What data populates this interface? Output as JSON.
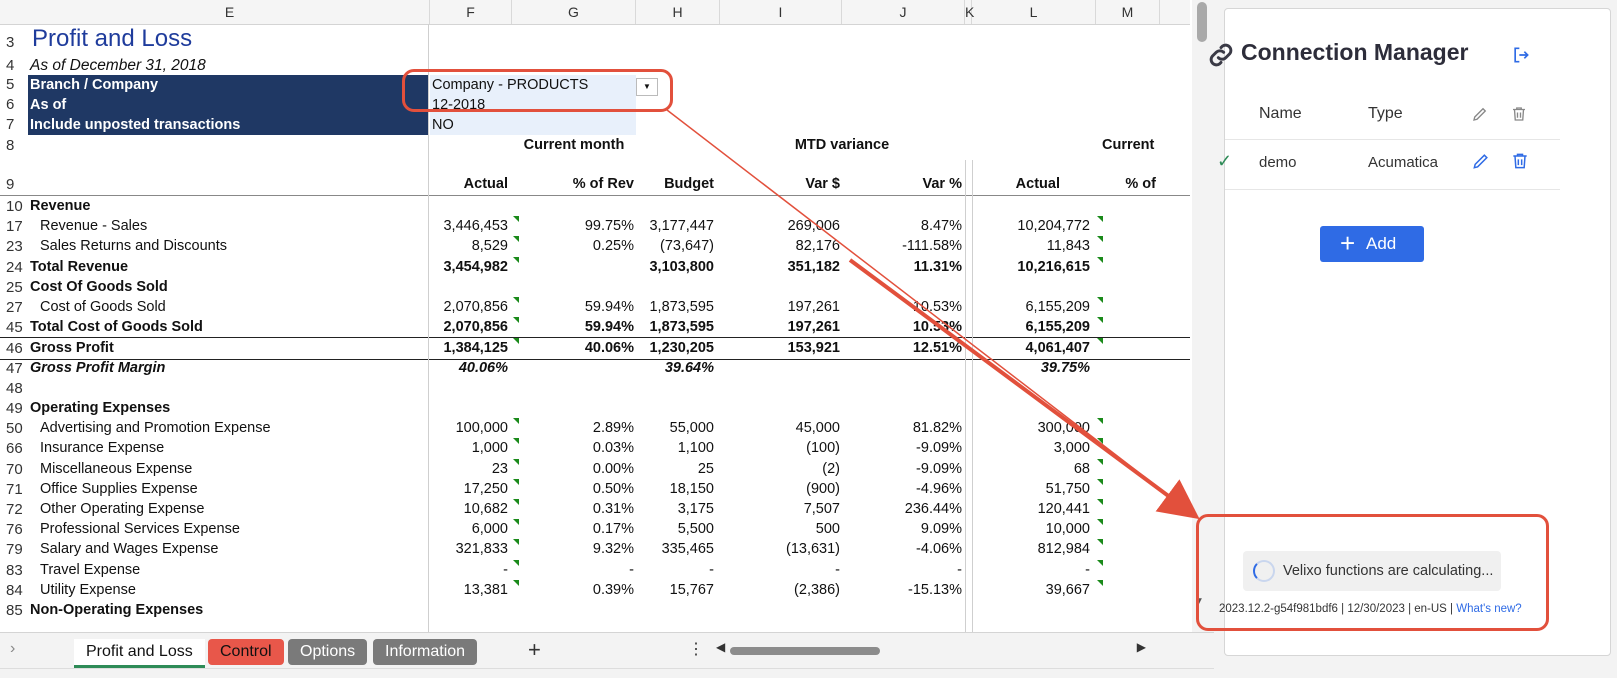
{
  "columns": [
    "E",
    "F",
    "G",
    "H",
    "I",
    "J",
    "K",
    "L",
    "M"
  ],
  "report": {
    "title": "Profit and Loss",
    "subtitle": "As of December 31, 2018",
    "params": [
      {
        "label": "Branch / Company",
        "value": "Company - PRODUCTS"
      },
      {
        "label": "As of",
        "value": "12-2018"
      },
      {
        "label": "Include unposted transactions",
        "value": "NO"
      }
    ],
    "group_headers": {
      "current_month": "Current month",
      "mtd_variance": "MTD variance",
      "current_ytd": "Current"
    },
    "col_headers": {
      "actual": "Actual",
      "pct_rev": "% of Rev",
      "budget": "Budget",
      "var_amt": "Var $",
      "var_pct": "Var %",
      "actual2": "Actual",
      "pct2": "% of"
    },
    "row_numbers": [
      "3",
      "4",
      "5",
      "6",
      "7",
      "8",
      "9",
      "10",
      "17",
      "23",
      "24",
      "25",
      "27",
      "45",
      "46",
      "47",
      "48",
      "49",
      "50",
      "66",
      "70",
      "71",
      "72",
      "76",
      "79",
      "83",
      "84",
      "85"
    ],
    "lines": [
      {
        "rn": "10",
        "label": "Revenue",
        "bold": true,
        "indent": false,
        "vals": [
          "",
          "",
          "",
          "",
          "",
          "",
          ""
        ]
      },
      {
        "rn": "17",
        "label": "Revenue - Sales",
        "bold": false,
        "indent": true,
        "vals": [
          "3,446,453",
          "99.75%",
          "3,177,447",
          "269,006",
          "8.47%",
          "10,204,772",
          ""
        ]
      },
      {
        "rn": "23",
        "label": "Sales Returns and Discounts",
        "bold": false,
        "indent": true,
        "vals": [
          "8,529",
          "0.25%",
          "(73,647)",
          "82,176",
          "-111.58%",
          "11,843",
          ""
        ]
      },
      {
        "rn": "24",
        "label": "Total Revenue",
        "bold": true,
        "indent": false,
        "vals": [
          "3,454,982",
          "",
          "3,103,800",
          "351,182",
          "11.31%",
          "10,216,615",
          ""
        ]
      },
      {
        "rn": "25",
        "label": "Cost Of Goods Sold",
        "bold": true,
        "indent": false,
        "vals": [
          "",
          "",
          "",
          "",
          "",
          "",
          ""
        ]
      },
      {
        "rn": "27",
        "label": "Cost of Goods Sold",
        "bold": false,
        "indent": true,
        "vals": [
          "2,070,856",
          "59.94%",
          "1,873,595",
          "197,261",
          "10.53%",
          "6,155,209",
          ""
        ]
      },
      {
        "rn": "45",
        "label": "Total Cost of Goods Sold",
        "bold": true,
        "indent": false,
        "vals": [
          "2,070,856",
          "59.94%",
          "1,873,595",
          "197,261",
          "10.53%",
          "6,155,209",
          ""
        ]
      },
      {
        "rn": "46",
        "label": "Gross Profit",
        "bold": true,
        "indent": false,
        "vals": [
          "1,384,125",
          "40.06%",
          "1,230,205",
          "153,921",
          "12.51%",
          "4,061,407",
          ""
        ]
      },
      {
        "rn": "47",
        "label": "Gross Profit Margin",
        "bold": true,
        "italic": true,
        "indent": false,
        "vals": [
          "40.06%",
          "",
          "39.64%",
          "",
          "",
          "39.75%",
          ""
        ]
      },
      {
        "rn": "48",
        "label": "",
        "bold": false,
        "indent": false,
        "vals": [
          "",
          "",
          "",
          "",
          "",
          "",
          ""
        ]
      },
      {
        "rn": "49",
        "label": "Operating Expenses",
        "bold": true,
        "indent": false,
        "vals": [
          "",
          "",
          "",
          "",
          "",
          "",
          ""
        ]
      },
      {
        "rn": "50",
        "label": "Advertising and Promotion Expense",
        "bold": false,
        "indent": true,
        "vals": [
          "100,000",
          "2.89%",
          "55,000",
          "45,000",
          "81.82%",
          "300,000",
          ""
        ]
      },
      {
        "rn": "66",
        "label": "Insurance Expense",
        "bold": false,
        "indent": true,
        "vals": [
          "1,000",
          "0.03%",
          "1,100",
          "(100)",
          "-9.09%",
          "3,000",
          ""
        ]
      },
      {
        "rn": "70",
        "label": "Miscellaneous Expense",
        "bold": false,
        "indent": true,
        "vals": [
          "23",
          "0.00%",
          "25",
          "(2)",
          "-9.09%",
          "68",
          ""
        ]
      },
      {
        "rn": "71",
        "label": "Office Supplies Expense",
        "bold": false,
        "indent": true,
        "vals": [
          "17,250",
          "0.50%",
          "18,150",
          "(900)",
          "-4.96%",
          "51,750",
          ""
        ]
      },
      {
        "rn": "72",
        "label": "Other Operating Expense",
        "bold": false,
        "indent": true,
        "vals": [
          "10,682",
          "0.31%",
          "3,175",
          "7,507",
          "236.44%",
          "120,441",
          ""
        ]
      },
      {
        "rn": "76",
        "label": "Professional Services Expense",
        "bold": false,
        "indent": true,
        "vals": [
          "6,000",
          "0.17%",
          "5,500",
          "500",
          "9.09%",
          "10,000",
          ""
        ]
      },
      {
        "rn": "79",
        "label": "Salary and Wages Expense",
        "bold": false,
        "indent": true,
        "vals": [
          "321,833",
          "9.32%",
          "335,465",
          "(13,631)",
          "-4.06%",
          "812,984",
          ""
        ]
      },
      {
        "rn": "83",
        "label": "Travel Expense",
        "bold": false,
        "indent": true,
        "vals": [
          "-",
          "-",
          "-",
          "-",
          "-",
          "-",
          ""
        ]
      },
      {
        "rn": "84",
        "label": "Utility Expense",
        "bold": false,
        "indent": true,
        "vals": [
          "13,381",
          "0.39%",
          "15,767",
          "(2,386)",
          "-15.13%",
          "39,667",
          ""
        ]
      },
      {
        "rn": "85",
        "label": "Non-Operating Expenses",
        "bold": true,
        "indent": false,
        "vals": [
          "",
          "",
          "",
          "",
          "",
          "",
          ""
        ]
      }
    ]
  },
  "sheet_tabs": [
    {
      "label": "Profit and Loss",
      "active": true
    },
    {
      "label": "Control",
      "color": "#e8574a"
    },
    {
      "label": "Options",
      "color": "#7a7a7a"
    },
    {
      "label": "Information",
      "color": "#7a7a7a"
    }
  ],
  "add_sheet": "+",
  "panel": {
    "title": "Connection Manager",
    "columns": {
      "name": "Name",
      "type": "Type"
    },
    "connections": [
      {
        "name": "demo",
        "type": "Acumatica"
      }
    ],
    "add_label": "Add",
    "status": "Velixo functions are calculating...",
    "version": "2023.12.2-g54f981bdf6 | 12/30/2023 | en-US | ",
    "whats_new": "What's new?",
    "accent": "#2f6be5"
  },
  "colors": {
    "annotation": "#e2503c",
    "param_bg": "#1f3864",
    "title": "#1f3c9c"
  }
}
